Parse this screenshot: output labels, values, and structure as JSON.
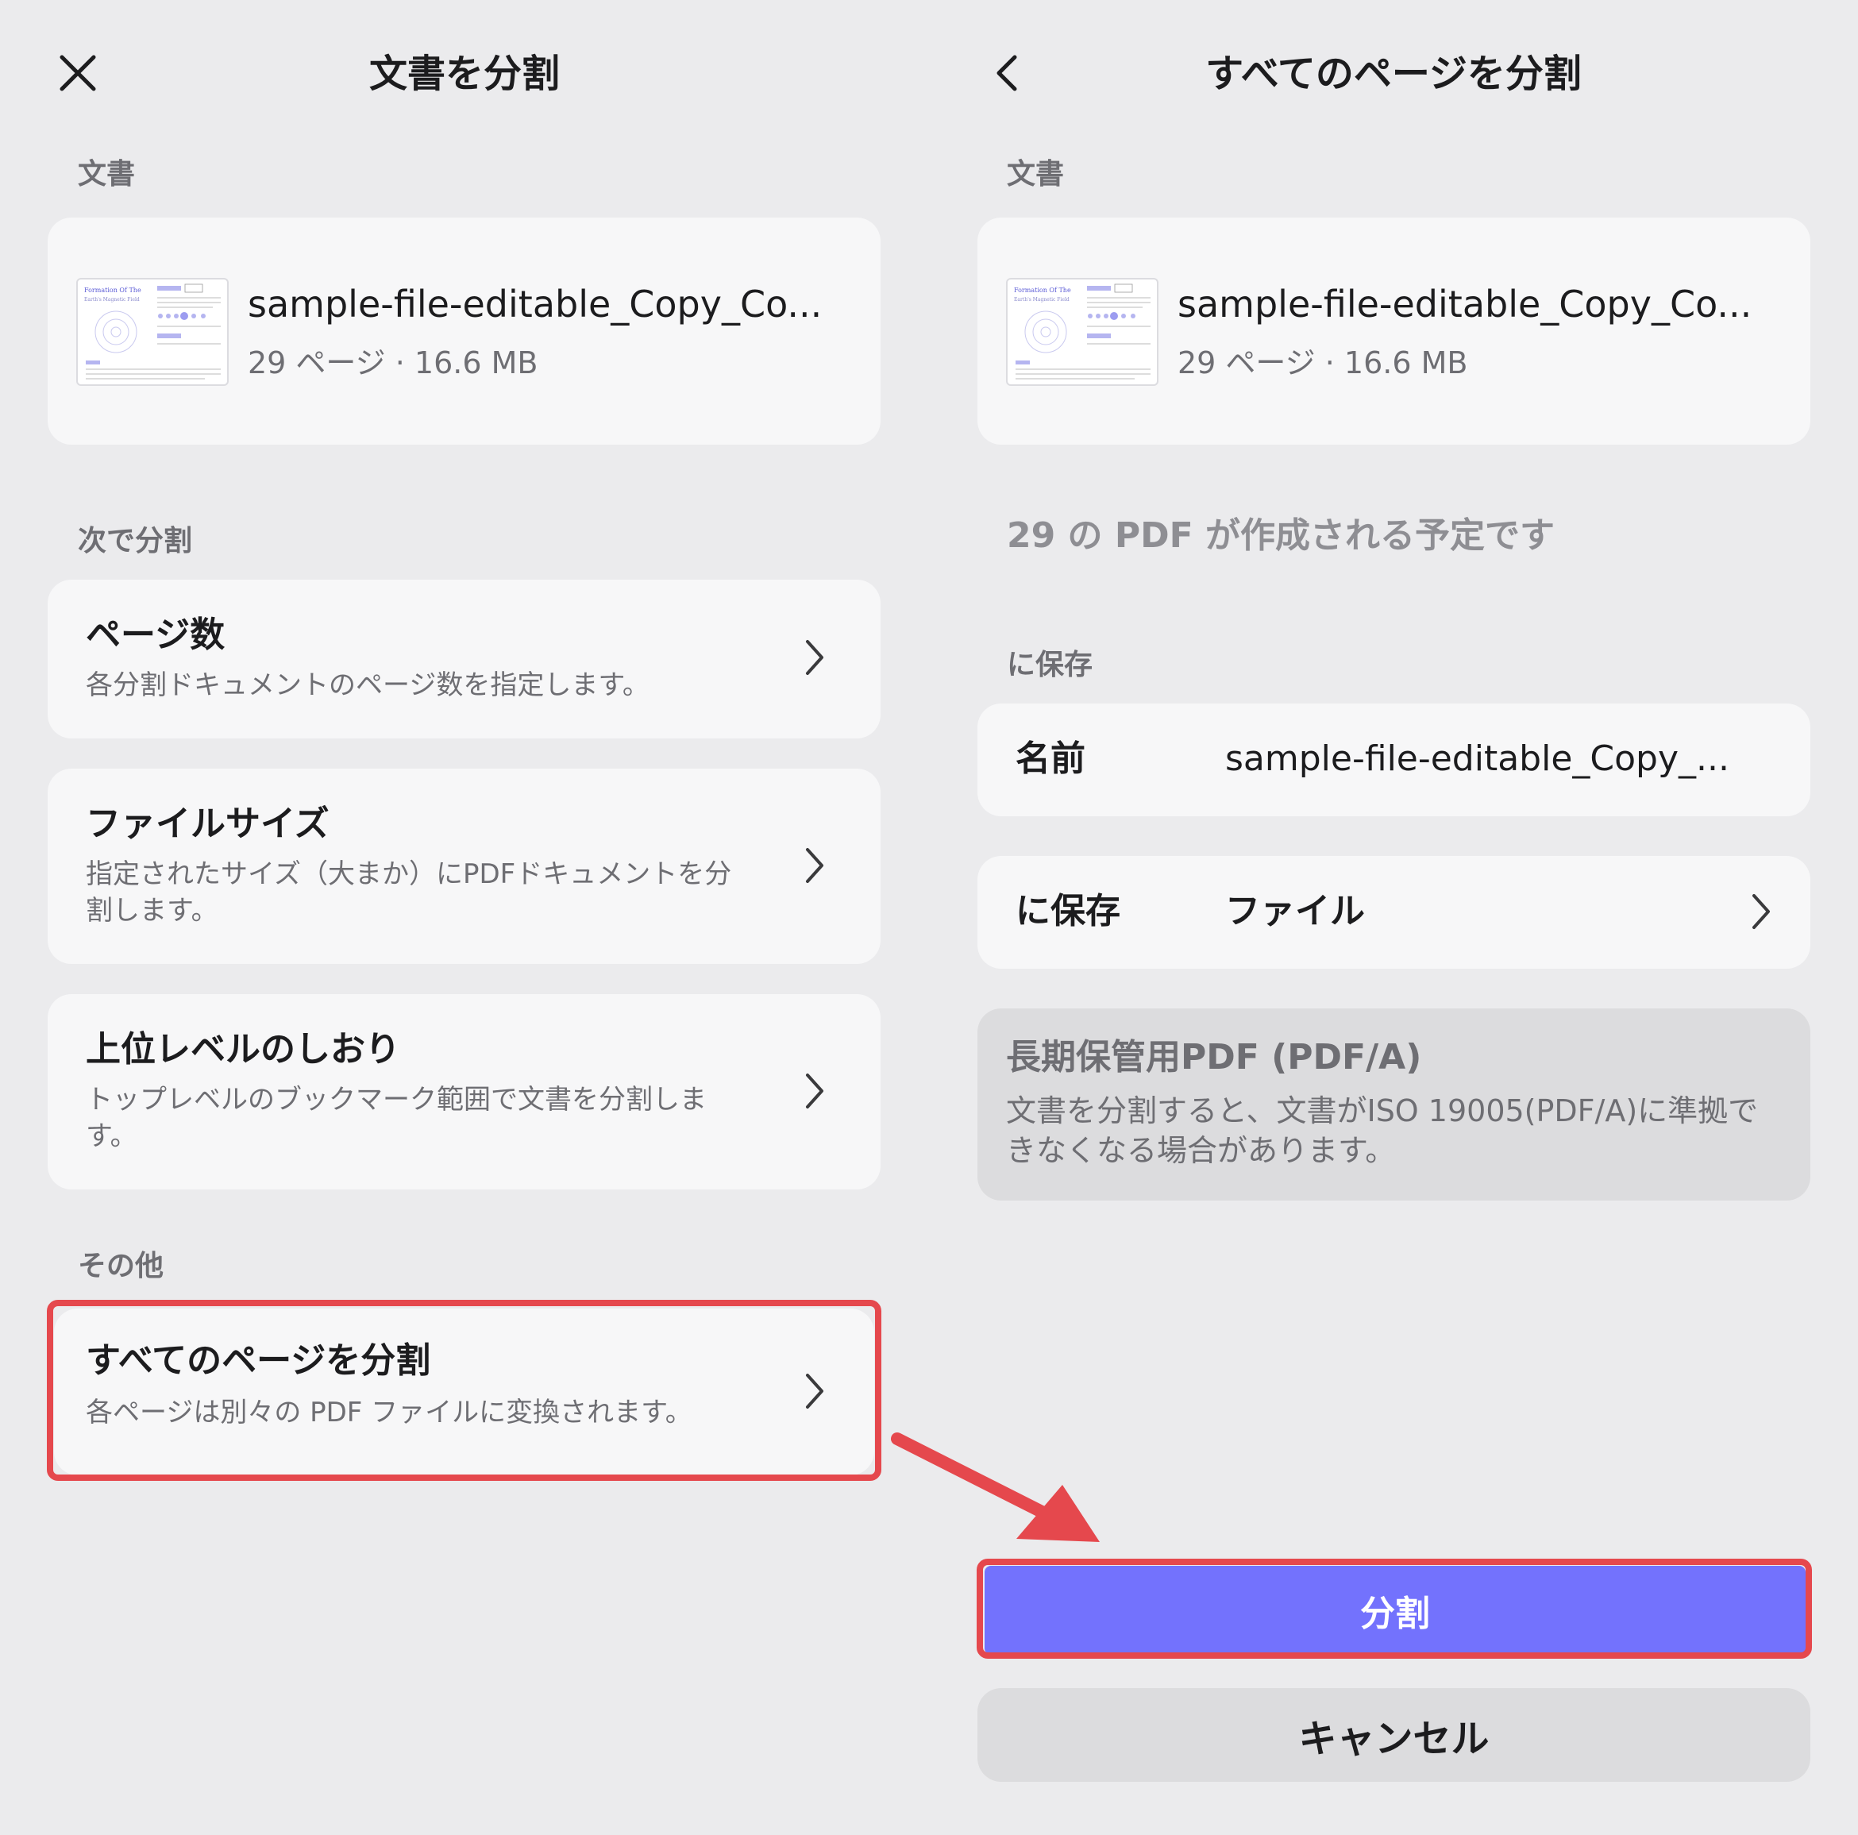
{
  "left": {
    "title": "文書を分割",
    "doc_section_label": "文書",
    "doc": {
      "name": "sample-file-editable_Copy_Co...",
      "meta": "29 ページ · 16.6 MB",
      "thumb_title": "Formation Of The",
      "thumb_subtitle": "Earth's Magnetic Field"
    },
    "split_by_label": "次で分割",
    "options": [
      {
        "title": "ページ数",
        "desc": "各分割ドキュメントのページ数を指定します。"
      },
      {
        "title": "ファイルサイズ",
        "desc": "指定されたサイズ（大まか）にPDFドキュメントを分割します。"
      },
      {
        "title": "上位レベルのしおり",
        "desc": "トップレベルのブックマーク範囲で文書を分割します。"
      }
    ],
    "other_label": "その他",
    "all_pages": {
      "title": "すべてのページを分割",
      "desc": "各ページは別々の PDF ファイルに変換されます。"
    }
  },
  "right": {
    "title": "すべてのページを分割",
    "doc_section_label": "文書",
    "doc": {
      "name": "sample-file-editable_Copy_Co...",
      "meta": "29 ページ · 16.6 MB",
      "thumb_title": "Formation Of The",
      "thumb_subtitle": "Earth's Magnetic Field"
    },
    "info": "29 の PDF が作成される予定です",
    "save_section_label": "に保存",
    "name_row": {
      "label": "名前",
      "value": "sample-file-editable_Copy_..."
    },
    "save_row": {
      "label": "に保存",
      "value": "ファイル"
    },
    "pdfa": {
      "title": "長期保管用PDF (PDF/A)",
      "desc": "文書を分割すると、文書がISO 19005(PDF/A)に準拠できなくなる場合があります。"
    },
    "split_button": "分割",
    "cancel_button": "キャンセル"
  },
  "colors": {
    "accent": "#7372fd",
    "highlight": "#e5484d",
    "background": "#ebebed",
    "card": "#f7f7f8"
  },
  "icons": {
    "close": "close-icon",
    "back": "chevron-left-icon",
    "chevron": "chevron-right-icon",
    "arrow": "annotation-arrow"
  }
}
